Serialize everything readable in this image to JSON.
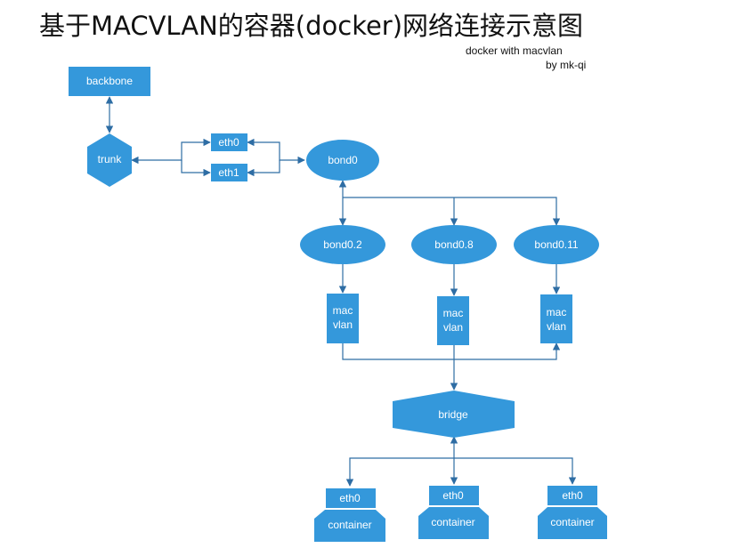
{
  "title": "基于MACVLAN的容器(docker)网络连接示意图",
  "subtitle_line1": "docker with macvlan",
  "subtitle_line2": "by mk-qi",
  "colors": {
    "node_fill": "#3498db",
    "line": "#2e6da4",
    "text": "#ffffff"
  },
  "nodes": {
    "backbone": "backbone",
    "trunk": "trunk",
    "eth0": "eth0",
    "eth1": "eth1",
    "bond0": "bond0",
    "bond0_2": "bond0.2",
    "bond0_8": "bond0.8",
    "bond0_11": "bond0.11",
    "macvlan_line1": "mac",
    "macvlan_line2": "vlan",
    "bridge": "bridge",
    "container_eth": "eth0",
    "container": "container"
  }
}
